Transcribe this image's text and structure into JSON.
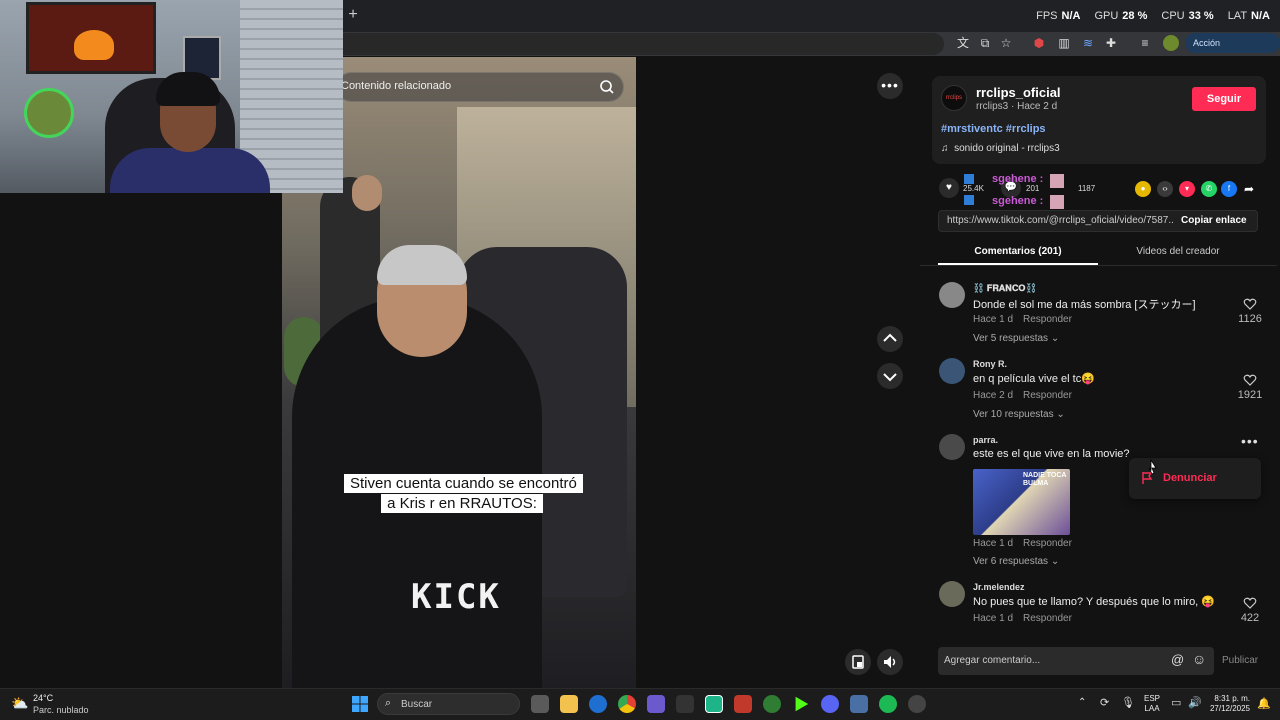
{
  "browser": {
    "new_tab": "+",
    "action_button": "Acción obligatoria"
  },
  "perf_overlay": {
    "fps_label": "FPS",
    "fps_value": "N/A",
    "gpu_label": "GPU",
    "gpu_value": "28 %",
    "cpu_label": "CPU",
    "cpu_value": "33 %",
    "lat_label": "LAT",
    "lat_value": "N/A"
  },
  "video": {
    "related_placeholder": "Contenido relacionado",
    "caption": "Stiven cuenta cuando se encontró a Kris r en RRAUTOS:",
    "watermark": "KICK"
  },
  "creator": {
    "name": "rrclips_oficial",
    "avatar_text": "rrclips",
    "sub": "rrclips3 · Hace 2 d",
    "follow_label": "Seguir",
    "hashtags": "#mrstiventc #rrclips",
    "sound": "sonido original - rrclips3"
  },
  "stats": {
    "likes": "25.4K",
    "comments": "201",
    "saves": "1187",
    "overlay_name_1": "sgehene :",
    "overlay_name_2": "sgehene :"
  },
  "link": {
    "url": "https://www.tiktok.com/@rrclips_oficial/video/7587...",
    "copy_label": "Copiar enlace"
  },
  "tabs": {
    "comments": "Comentarios (201)",
    "videos": "Videos del creador"
  },
  "comments": [
    {
      "name": "⛓️ 𝐅𝐑𝐀𝐍𝐂𝐎⛓️",
      "text": "Donde el sol me da más sombra [ステッカー]",
      "time": "Hace 1 d",
      "reply": "Responder",
      "likes": "1126",
      "more": "Ver 5 respuestas ⌄"
    },
    {
      "name": "Rony R.",
      "text": "en q película vive el tc😝",
      "time": "Hace 2 d",
      "reply": "Responder",
      "likes": "1921",
      "more": "Ver 10 respuestas ⌄"
    },
    {
      "name": "parra.",
      "text": "este es el que vive en la movie?",
      "time": "Hace 1 d",
      "reply": "Responder",
      "likes": "",
      "more": "Ver 6 respuestas ⌄",
      "image_text": "NADIE TOCA BULMA"
    },
    {
      "name": "Jr.melendez",
      "text": "No pues que te llamo? Y después que lo miro, 😝",
      "time": "Hace 1 d",
      "reply": "Responder",
      "likes": "422",
      "more": ""
    }
  ],
  "report_menu": {
    "label": "Denunciar"
  },
  "comment_box": {
    "placeholder": "Agregar comentario...",
    "publish_label": "Publicar"
  },
  "taskbar": {
    "weather_temp": "24°C",
    "weather_desc": "Parc. nublado",
    "search_label": "Buscar",
    "lang_line1": "ESP",
    "lang_line2": "LAA",
    "time": "8:31 p. m.",
    "date": "27/12/2025"
  },
  "colors": {
    "accent": "#fe2c55",
    "hashtag": "#8ab4f8",
    "background": "#121212"
  }
}
